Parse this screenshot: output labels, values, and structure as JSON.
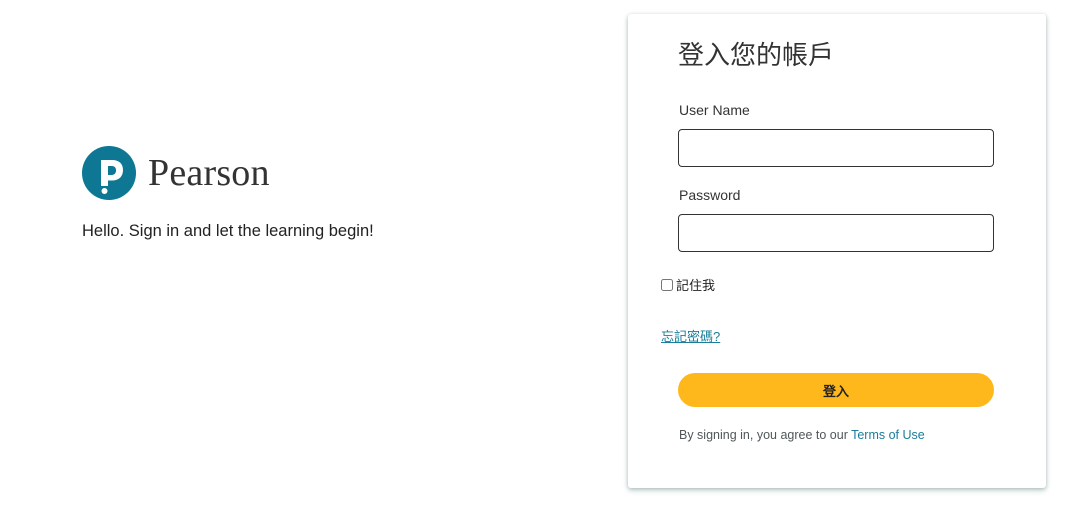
{
  "brand": {
    "logo_text": "Pearson",
    "logo_letter": "P",
    "tagline": "Hello. Sign in and let the learning begin!",
    "logo_color": "#0d7794"
  },
  "login": {
    "title": "登入您的帳戶",
    "username_label": "User Name",
    "username_value": "",
    "password_label": "Password",
    "password_value": "",
    "remember_label": "記住我",
    "remember_checked": false,
    "forgot_label": "忘記密碼?",
    "submit_label": "登入",
    "agree_text": "By signing in, you agree to our ",
    "terms_label": "Terms of Use"
  },
  "colors": {
    "button_bg": "#ffb81c",
    "link": "#1a7d9a",
    "card_shadow": "#1e786e"
  },
  "icons": {
    "logo": "pearson-logo-icon"
  }
}
